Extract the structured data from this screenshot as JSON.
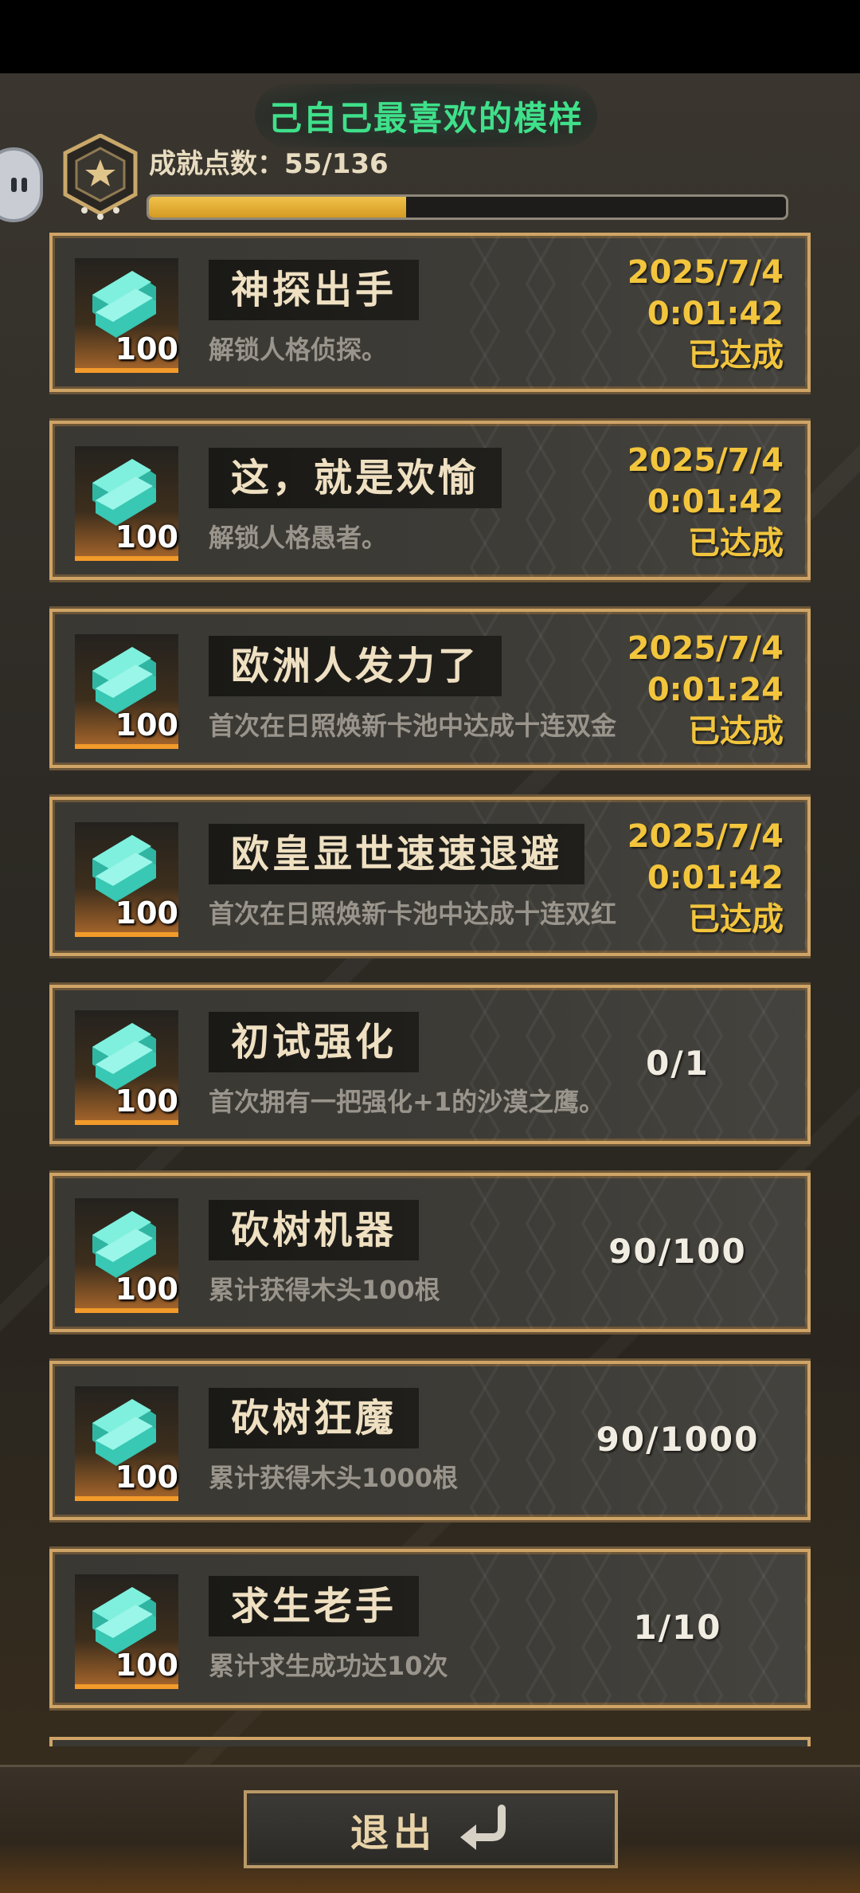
{
  "header": {
    "banner_text": "己自己最喜欢的模样",
    "points_label": "成就点数：55/136",
    "points_current": 55,
    "points_total": 136,
    "progress_fraction": 0.404
  },
  "achievements": [
    {
      "title": "神探出手",
      "desc": "解锁人格侦探。",
      "reward": "100",
      "date": "2025/7/4",
      "time": "0:01:42",
      "status": "已达成"
    },
    {
      "title": "这，就是欢愉",
      "desc": "解锁人格愚者。",
      "reward": "100",
      "date": "2025/7/4",
      "time": "0:01:42",
      "status": "已达成"
    },
    {
      "title": "欧洲人发力了",
      "desc": "首次在日照焕新卡池中达成十连双金",
      "reward": "100",
      "date": "2025/7/4",
      "time": "0:01:24",
      "status": "已达成"
    },
    {
      "title": "欧皇显世速速退避",
      "desc": "首次在日照焕新卡池中达成十连双红",
      "reward": "100",
      "date": "2025/7/4",
      "time": "0:01:42",
      "status": "已达成"
    },
    {
      "title": "初试强化",
      "desc": "首次拥有一把强化+1的沙漠之鹰。",
      "reward": "100",
      "progress": "0/1"
    },
    {
      "title": "砍树机器",
      "desc": "累计获得木头100根",
      "reward": "100",
      "progress": "90/100"
    },
    {
      "title": "砍树狂魔",
      "desc": "累计获得木头1000根",
      "reward": "100",
      "progress": "90/1000"
    },
    {
      "title": "求生老手",
      "desc": "累计求生成功达10次",
      "reward": "100",
      "progress": "1/10"
    }
  ],
  "footer": {
    "exit_label": "退出"
  },
  "icons": {
    "reward": "ticket-icon",
    "medal": "medal-icon",
    "exit": "return-arrow-icon",
    "side": "pause-icon"
  },
  "colors": {
    "accent_gold": "#f2c53d",
    "banner_green": "#3fe08a",
    "card_border": "#cfa466",
    "reward_orange": "#f29a2a"
  }
}
